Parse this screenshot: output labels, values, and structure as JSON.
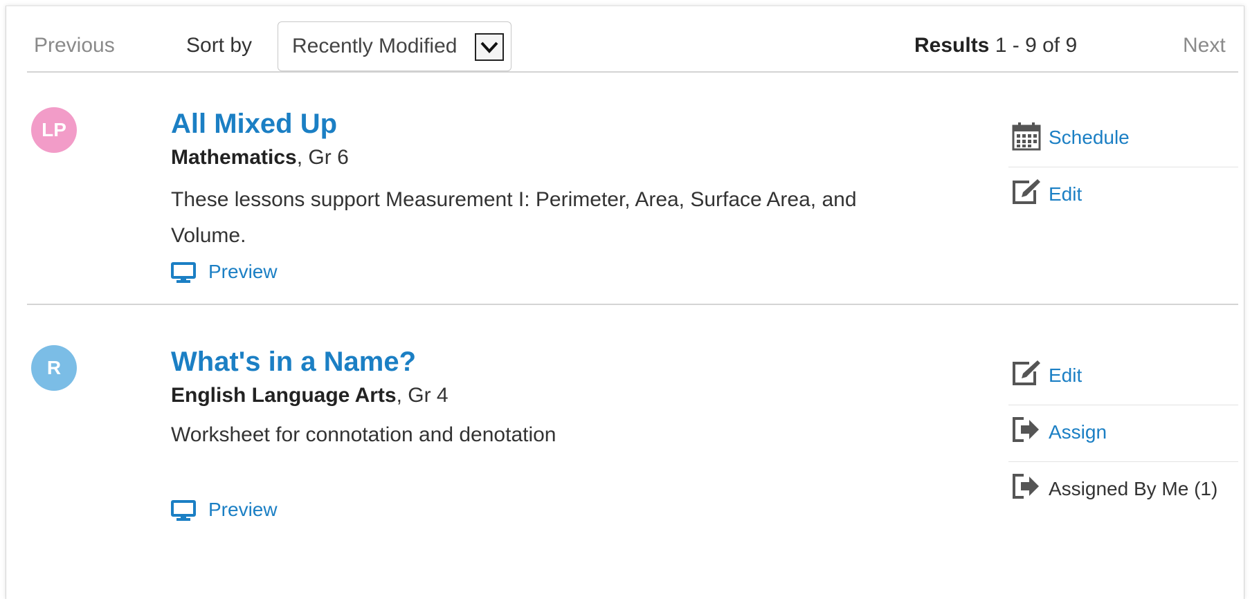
{
  "toolbar": {
    "previous": "Previous",
    "sort_by_label": "Sort by",
    "sort_value": "Recently Modified",
    "results_label": "Results",
    "results_range": "1 - 9 of 9",
    "next": "Next"
  },
  "items": [
    {
      "avatar": "LP",
      "avatar_color": "#f29cc8",
      "title": "All Mixed Up",
      "subject": "Mathematics",
      "grade": ", Gr 6",
      "description": "These lessons support Measurement I: Perimeter, Area, Surface Area, and Volume.",
      "preview": "Preview",
      "actions": [
        "Schedule",
        "Edit"
      ]
    },
    {
      "avatar": "R",
      "avatar_color": "#7bbde6",
      "title": "What's in a Name?",
      "subject": "English Language Arts",
      "grade": ", Gr 4",
      "description": "Worksheet for connotation and denotation",
      "preview": "Preview",
      "actions": [
        "Edit",
        "Assign",
        "Assigned By Me (1)"
      ]
    }
  ],
  "colors": {
    "link": "#1b7fc4",
    "muted": "#8a8a8a",
    "divider": "#d4d4d4"
  }
}
